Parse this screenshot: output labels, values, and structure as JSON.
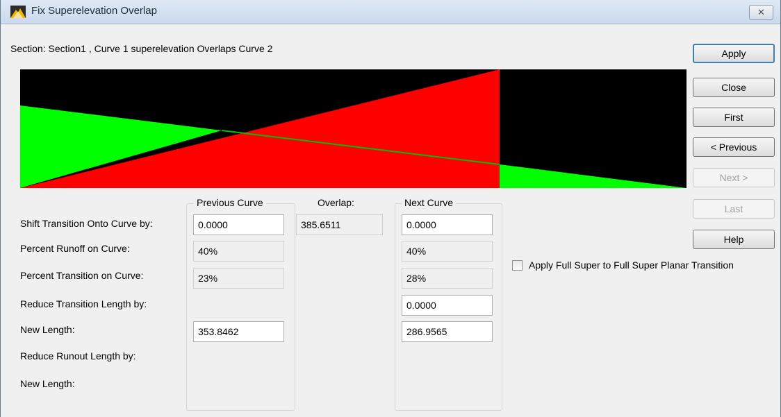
{
  "window": {
    "title": "Fix Superelevation Overlap",
    "close_glyph": "✕"
  },
  "section_label": "Section: Section1 , Curve 1 superelevation Overlaps Curve 2",
  "buttons": {
    "apply": "Apply",
    "close": "Close",
    "first": "First",
    "previous": "< Previous",
    "next": "Next >",
    "last": "Last",
    "help": "Help"
  },
  "row_labels": {
    "shift_transition": "Shift Transition Onto Curve by:",
    "percent_runoff": "Percent Runoff on Curve:",
    "percent_transition": "Percent Transition on Curve:",
    "reduce_transition": "Reduce Transition Length by:",
    "new_length_1": "New Length:",
    "reduce_runout": "Reduce Runout Length by:",
    "new_length_2": "New Length:"
  },
  "previous_curve": {
    "title": "Previous Curve",
    "shift": "0.0000",
    "runoff": "40%",
    "transition": "23%",
    "new_length": "353.8462"
  },
  "overlap": {
    "title": "Overlap:",
    "value": "385.6511"
  },
  "next_curve": {
    "title": "Next Curve",
    "shift": "0.0000",
    "runoff": "40%",
    "transition": "28%",
    "reduce_transition": "0.0000",
    "new_length": "286.9565"
  },
  "apply_full_super_label": "Apply Full Super to Full Super Planar Transition",
  "colors": {
    "canvas_bg": "#000000",
    "previous_curve_fill": "#00ff00",
    "next_curve_fill": "#ff0000",
    "default_button_border": "#3c7fb1"
  }
}
